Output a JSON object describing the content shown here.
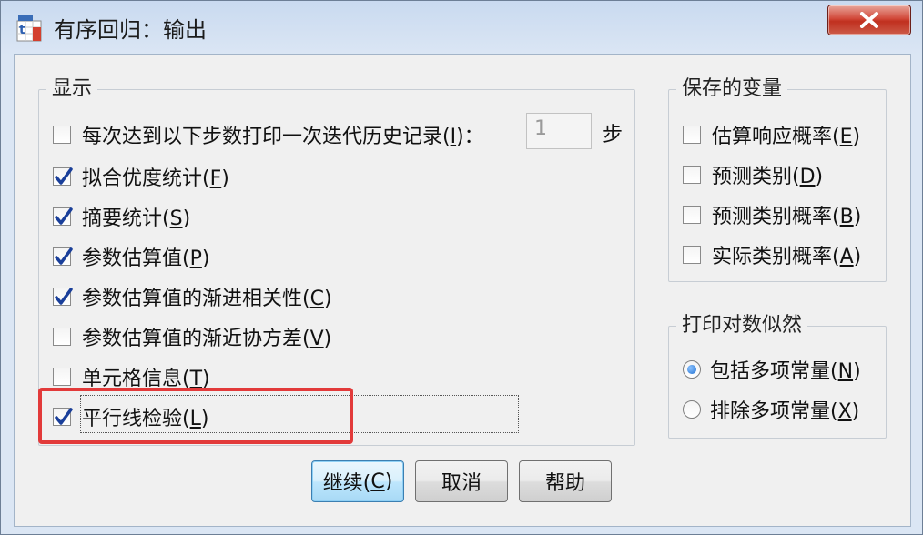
{
  "window": {
    "title": "有序回归：输出",
    "close_label": "X"
  },
  "display_group": {
    "legend": "显示",
    "iteration_history": {
      "label": "每次达到以下步数打印一次迭代历史记录(",
      "mnemonic": "I",
      "suffix": ")：",
      "value": "1",
      "unit": "步",
      "checked": false
    },
    "items": [
      {
        "label": "拟合优度统计(",
        "mnemonic": "F",
        "suffix": ")",
        "checked": true
      },
      {
        "label": "摘要统计(",
        "mnemonic": "S",
        "suffix": ")",
        "checked": true
      },
      {
        "label": "参数估算值(",
        "mnemonic": "P",
        "suffix": ")",
        "checked": true
      },
      {
        "label": "参数估算值的渐进相关性(",
        "mnemonic": "C",
        "suffix": ")",
        "checked": true
      },
      {
        "label": "参数估算值的渐近协方差(",
        "mnemonic": "V",
        "suffix": ")",
        "checked": false
      },
      {
        "label": "单元格信息(",
        "mnemonic": "T",
        "suffix": ")",
        "checked": false
      },
      {
        "label": "平行线检验(",
        "mnemonic": "L",
        "suffix": ")",
        "checked": true
      }
    ]
  },
  "saved_vars_group": {
    "legend": "保存的变量",
    "items": [
      {
        "label": "估算响应概率(",
        "mnemonic": "E",
        "suffix": ")",
        "checked": false
      },
      {
        "label": "预测类别(",
        "mnemonic": "D",
        "suffix": ")",
        "checked": false
      },
      {
        "label": "预测类别概率(",
        "mnemonic": "B",
        "suffix": ")",
        "checked": false
      },
      {
        "label": "实际类别概率(",
        "mnemonic": "A",
        "suffix": ")",
        "checked": false
      }
    ]
  },
  "loglik_group": {
    "legend": "打印对数似然",
    "options": [
      {
        "label": "包括多项常量(",
        "mnemonic": "N",
        "suffix": ")",
        "selected": true
      },
      {
        "label": "排除多项常量(",
        "mnemonic": "X",
        "suffix": ")",
        "selected": false
      }
    ]
  },
  "buttons": {
    "continue": {
      "label": "继续(",
      "mnemonic": "C",
      "suffix": ")"
    },
    "cancel": "取消",
    "help": "帮助"
  },
  "colors": {
    "highlight": "#e23a3a",
    "check": "#1a3f9a",
    "radio": "#1f6fd1"
  }
}
